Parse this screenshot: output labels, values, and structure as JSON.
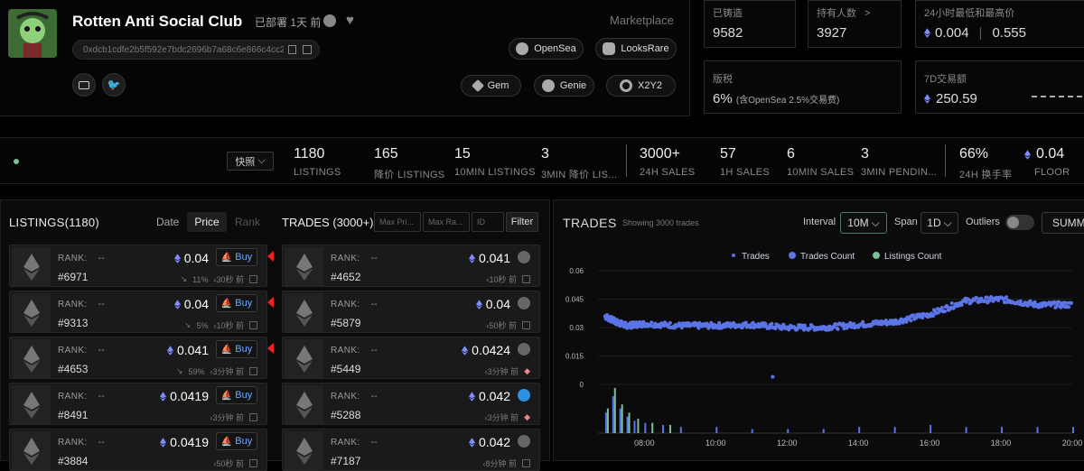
{
  "collection": {
    "name": "Rotten Anti Social Club",
    "deployed": "已部署 1天 前",
    "address": "0xdcb1cdfe2b5f592e7bdc2696b7a68c6e866c4cc2",
    "marketplace_label": "Marketplace"
  },
  "markets": {
    "opensea": "OpenSea",
    "looksrare": "LooksRare",
    "gem": "Gem",
    "genie": "Genie",
    "x2y2": "X2Y2"
  },
  "stats": {
    "minted_label": "已铸造",
    "minted_value": "9582",
    "holders_label": "持有人数",
    "holders_value": "3927",
    "range_label": "24小时最低和最高价",
    "range_low": "0.004",
    "range_high": "0.555",
    "royalty_label": "版税",
    "royalty_value": "6%",
    "royalty_note": "(含OpenSea 2.5%交易费)",
    "vol7d_label": "7D交易额",
    "vol7d_value": "250.59"
  },
  "snapshot_button": "快照",
  "metrics": [
    {
      "value": "1180",
      "label": "LISTINGS"
    },
    {
      "value": "165",
      "label": "降价 LISTINGS"
    },
    {
      "value": "15",
      "label": "10MIN LISTINGS"
    },
    {
      "value": "3",
      "label": "3MIN 降价 LIS..."
    },
    {
      "value": "3000+",
      "label": "24H SALES"
    },
    {
      "value": "57",
      "label": "1H SALES"
    },
    {
      "value": "6",
      "label": "10MIN SALES"
    },
    {
      "value": "3",
      "label": "3MIN PENDIN..."
    },
    {
      "value": "66%",
      "label": "24H 换手率"
    },
    {
      "value": "0.04",
      "label": "FLOOR"
    }
  ],
  "listings": {
    "title": "LISTINGS(1180)",
    "sort_date": "Date",
    "sort_price": "Price",
    "sort_rank": "Rank",
    "rank_label": "RANK:",
    "rank_value": "--",
    "buy_label": "Buy",
    "rows": [
      {
        "token": "#6971",
        "price": "0.04",
        "pct": "11%",
        "time": "30秒 前"
      },
      {
        "token": "#9313",
        "price": "0.04",
        "pct": "5%",
        "time": "10秒 前"
      },
      {
        "token": "#4653",
        "price": "0.041",
        "pct": "59%",
        "time": "3分钟 前"
      },
      {
        "token": "#8491",
        "price": "0.0419",
        "pct": "",
        "time": "3分钟 前"
      },
      {
        "token": "#3884",
        "price": "0.0419",
        "pct": "",
        "time": "50秒 前"
      }
    ]
  },
  "trades": {
    "title": "TRADES (3000+)",
    "max_price_placeholder": "Max Pri...",
    "max_rank_placeholder": "Max Ra...",
    "id_placeholder": "ID",
    "filter_label": "Filter",
    "rows": [
      {
        "token": "#4652",
        "price": "0.041",
        "time": "10秒 前"
      },
      {
        "token": "#5879",
        "price": "0.04",
        "time": "50秒 前"
      },
      {
        "token": "#5449",
        "price": "0.0424",
        "time": "3分钟 前"
      },
      {
        "token": "#5288",
        "price": "0.042",
        "time": "3分钟 前"
      },
      {
        "token": "#7187",
        "price": "0.042",
        "time": "8分钟 前"
      }
    ]
  },
  "chart_panel": {
    "title": "TRADES",
    "subtitle": "Showing 3000 trades",
    "interval_label": "Interval",
    "interval_value": "10M",
    "span_label": "Span",
    "span_value": "1D",
    "outliers_label": "Outliers",
    "summary_label": "SUMM"
  },
  "chart_data": {
    "type": "scatter",
    "legend": [
      "Trades",
      "Trades Count",
      "Listings Count"
    ],
    "legend_placement": "top",
    "colors": {
      "trades": "#5b74e6",
      "trades_count": "#5b74e6",
      "listings_count": "#7fbf9a"
    },
    "y_ticks": [
      0,
      0.015,
      0.03,
      0.045,
      0.06
    ],
    "x_ticks": [
      "08:00",
      "10:00",
      "12:00",
      "14:00",
      "16:00",
      "18:00",
      "20:00"
    ],
    "ylim": [
      0,
      0.06
    ],
    "trend": [
      {
        "x": 6.9,
        "y": 0.036
      },
      {
        "x": 7.2,
        "y": 0.033
      },
      {
        "x": 7.5,
        "y": 0.031
      },
      {
        "x": 8.0,
        "y": 0.032
      },
      {
        "x": 9.0,
        "y": 0.031
      },
      {
        "x": 10.0,
        "y": 0.031
      },
      {
        "x": 11.0,
        "y": 0.0315
      },
      {
        "x": 12.0,
        "y": 0.03
      },
      {
        "x": 13.0,
        "y": 0.03
      },
      {
        "x": 14.0,
        "y": 0.0315
      },
      {
        "x": 15.0,
        "y": 0.033
      },
      {
        "x": 16.0,
        "y": 0.037
      },
      {
        "x": 17.0,
        "y": 0.044
      },
      {
        "x": 18.0,
        "y": 0.045
      },
      {
        "x": 19.0,
        "y": 0.042
      },
      {
        "x": 20.0,
        "y": 0.042
      }
    ],
    "outliers": [
      {
        "x": 11.6,
        "y": 0.004
      }
    ],
    "bars_count": [
      {
        "x": 6.9,
        "v": 10
      },
      {
        "x": 7.1,
        "v": 18
      },
      {
        "x": 7.3,
        "v": 12
      },
      {
        "x": 7.5,
        "v": 8
      },
      {
        "x": 7.7,
        "v": 6
      },
      {
        "x": 8.0,
        "v": 5
      },
      {
        "x": 8.5,
        "v": 4
      },
      {
        "x": 9.0,
        "v": 3
      },
      {
        "x": 10.0,
        "v": 3
      },
      {
        "x": 11.0,
        "v": 2
      },
      {
        "x": 12.0,
        "v": 2
      },
      {
        "x": 13.0,
        "v": 2
      },
      {
        "x": 14.0,
        "v": 3
      },
      {
        "x": 15.0,
        "v": 3
      },
      {
        "x": 16.0,
        "v": 4
      },
      {
        "x": 17.0,
        "v": 3
      },
      {
        "x": 18.0,
        "v": 3
      },
      {
        "x": 19.0,
        "v": 3
      },
      {
        "x": 20.0,
        "v": 3
      }
    ],
    "bars_listings": [
      {
        "x": 6.95,
        "v": 12
      },
      {
        "x": 7.15,
        "v": 22
      },
      {
        "x": 7.35,
        "v": 14
      },
      {
        "x": 7.55,
        "v": 10
      },
      {
        "x": 7.8,
        "v": 7
      },
      {
        "x": 8.2,
        "v": 5
      },
      {
        "x": 8.7,
        "v": 4
      }
    ]
  }
}
